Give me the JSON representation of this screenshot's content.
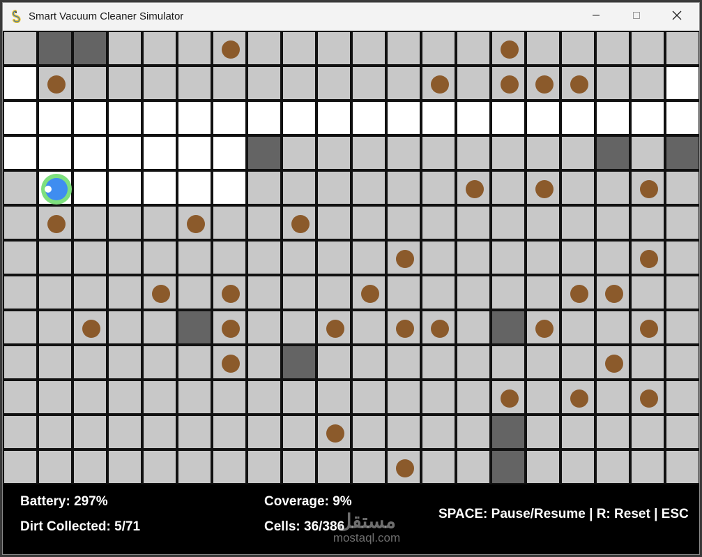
{
  "window": {
    "title": "Smart Vacuum Cleaner Simulator",
    "icon": "pygame-snake-icon",
    "controls": [
      "minimize-icon",
      "maximize-icon",
      "close-icon"
    ]
  },
  "colors": {
    "floor": "#c8c8c8",
    "cleaned": "#ffffff",
    "obstacle": "#646464",
    "dirt": "#8b5a2b",
    "robot_body": "#3f8df0",
    "robot_ring": "#7ee07e",
    "grid_line": "#111111",
    "hud_background": "#000000",
    "hud_text": "#ffffff"
  },
  "grid": {
    "columns": 20,
    "rows": 13,
    "legend": {
      "f": "floor",
      "c": "cleaned",
      "o": "obstacle",
      "d": "floor with dirt",
      "R": "robot"
    },
    "cells": [
      "foofffdfffffffdfffff",
      "cdffffffffffdfdddffc",
      "cccccccccccccccccccc",
      "cccccccofffffffffofo",
      "fRcccccffffffdfdffdf",
      "fdfffdffdfffffffffff",
      "fffffffffffdffffffdf",
      "ffffdfdfffdfffffddff",
      "ffdffodffdfddfodffdf",
      "ffffffdfoffffffffdff",
      "ffffffffffffffdfdfdf",
      "fffffffffdffffofffff",
      "fffffffffffdffofffff"
    ],
    "robot": {
      "row": 4,
      "col": 1,
      "facing": "left"
    }
  },
  "hud": {
    "battery": "Battery: 297%",
    "dirt_collected": "Dirt Collected: 5/71",
    "coverage": "Coverage: 9%",
    "cells": "Cells: 36/386",
    "help": "SPACE: Pause/Resume | R: Reset | ESC"
  },
  "watermark": {
    "arabic": "مستقل",
    "latin": "mostaql.com"
  }
}
